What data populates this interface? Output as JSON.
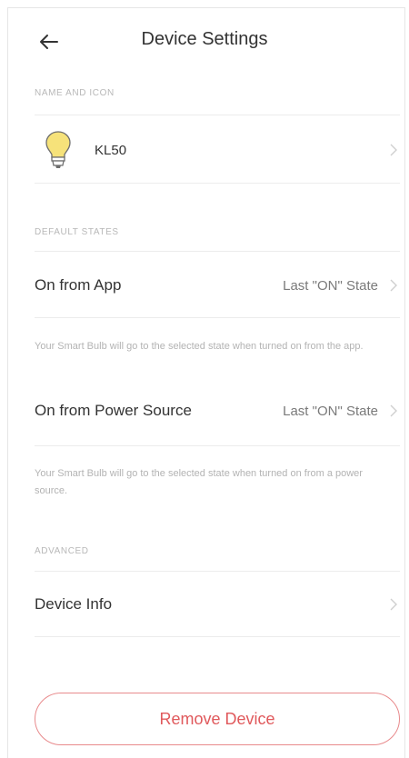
{
  "header": {
    "title": "Device Settings",
    "back_icon": "arrow-left-icon"
  },
  "sections": {
    "name_and_icon": {
      "label": "NAME AND ICON",
      "device_name": "KL50",
      "device_icon": "bulb-icon"
    },
    "default_states": {
      "label": "DEFAULT STATES",
      "rows": [
        {
          "label": "On from App",
          "value": "Last \"ON\" State",
          "helper": "Your Smart Bulb will go to the selected state when turned on from the app."
        },
        {
          "label": "On from Power Source",
          "value": "Last \"ON\" State",
          "helper": "Your Smart Bulb will go to the selected state when turned on from a power source."
        }
      ]
    },
    "advanced": {
      "label": "ADVANCED",
      "device_info_label": "Device Info"
    }
  },
  "actions": {
    "remove_label": "Remove Device"
  },
  "colors": {
    "accent_red": "#e0595c",
    "bulb_yellow": "#f6e27a",
    "text_primary": "#333333",
    "text_muted": "#b3b3b3"
  }
}
